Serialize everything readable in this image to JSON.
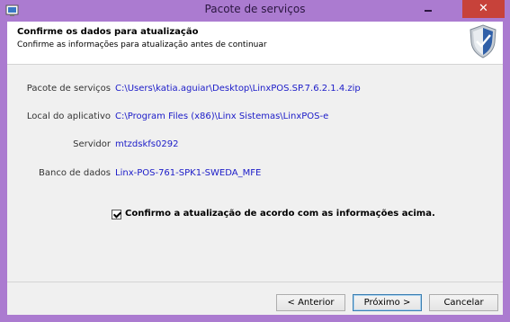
{
  "window": {
    "title": "Pacote de serviços",
    "close_symbol": "✕"
  },
  "header": {
    "title": "Confirme os dados para atualização",
    "subtitle": "Confirme as informações para atualização antes de continuar",
    "icon": "shield-check-icon"
  },
  "fields": [
    {
      "label": "Pacote de serviços",
      "value": "C:\\Users\\katia.aguiar\\Desktop\\LinxPOS.SP.7.6.2.1.4.zip"
    },
    {
      "label": "Local do aplicativo",
      "value": "C:\\Program Files (x86)\\Linx Sistemas\\LinxPOS-e"
    },
    {
      "label": "Servidor",
      "value": "mtzdskfs0292"
    },
    {
      "label": "Banco de dados",
      "value": "Linx-POS-761-SPK1-SWEDA_MFE"
    }
  ],
  "confirm": {
    "checked": true,
    "label": "Confirmo a atualização de acordo com as informações acima."
  },
  "buttons": {
    "back": "< Anterior",
    "next": "Próximo >",
    "cancel": "Cancelar"
  },
  "colors": {
    "titlebar": "#ab7bd0",
    "close": "#c7423a",
    "value_text": "#1b1bc8"
  }
}
